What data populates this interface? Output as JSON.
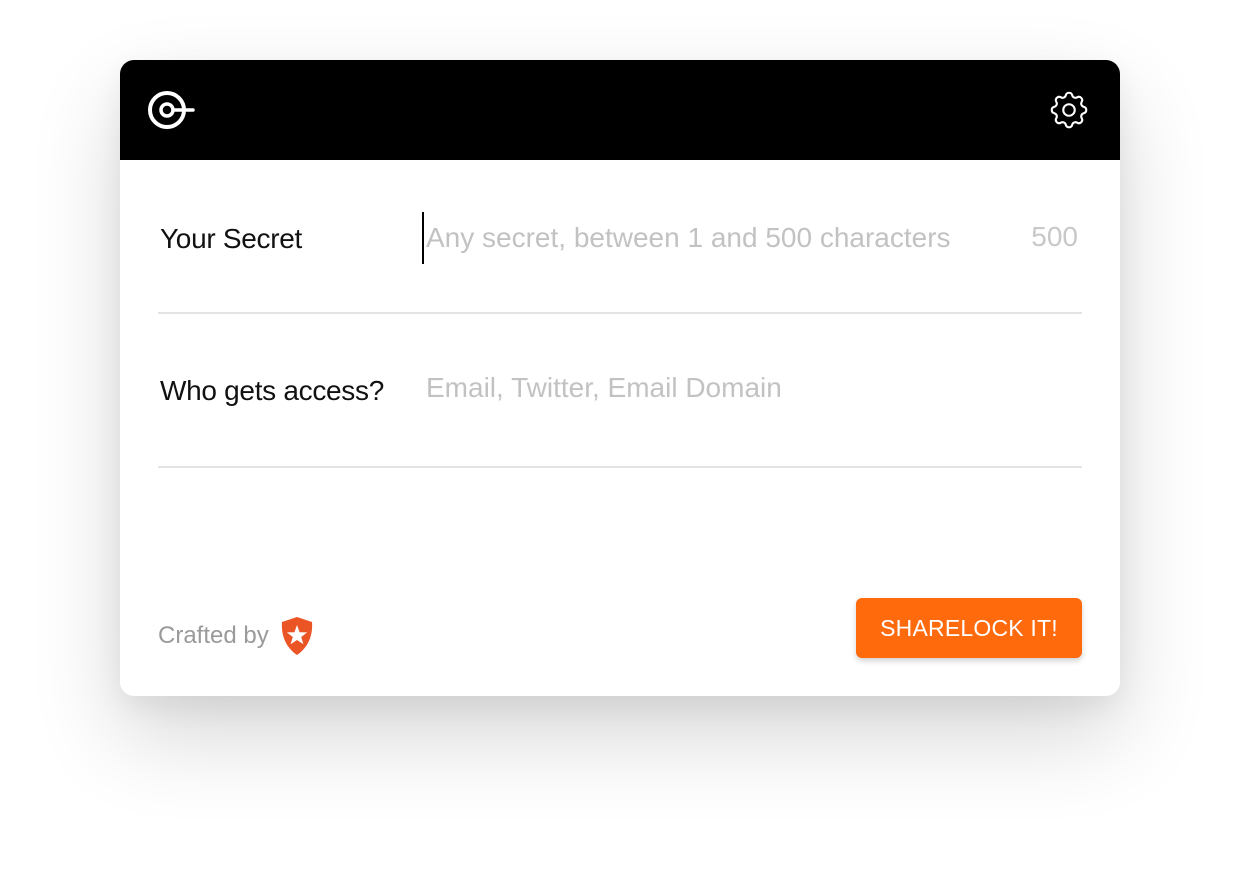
{
  "header": {
    "logo_icon": "sharelock-logo-icon",
    "settings_icon": "gear-icon"
  },
  "form": {
    "secret": {
      "label": "Your Secret",
      "placeholder": "Any secret, between 1 and 500 characters",
      "value": "",
      "counter": "500"
    },
    "access": {
      "label": "Who gets access?",
      "placeholder": "Email, Twitter, Email Domain",
      "value": ""
    }
  },
  "footer": {
    "credit_text": "Crafted by",
    "credit_icon": "auth0-shield-icon",
    "submit_label": "SHARELOCK IT!"
  },
  "colors": {
    "header_bg": "#000000",
    "accent": "#ff6a0d",
    "placeholder": "#c2c2c2",
    "divider": "#e4e4e4",
    "auth0_brand": "#eb5424"
  }
}
